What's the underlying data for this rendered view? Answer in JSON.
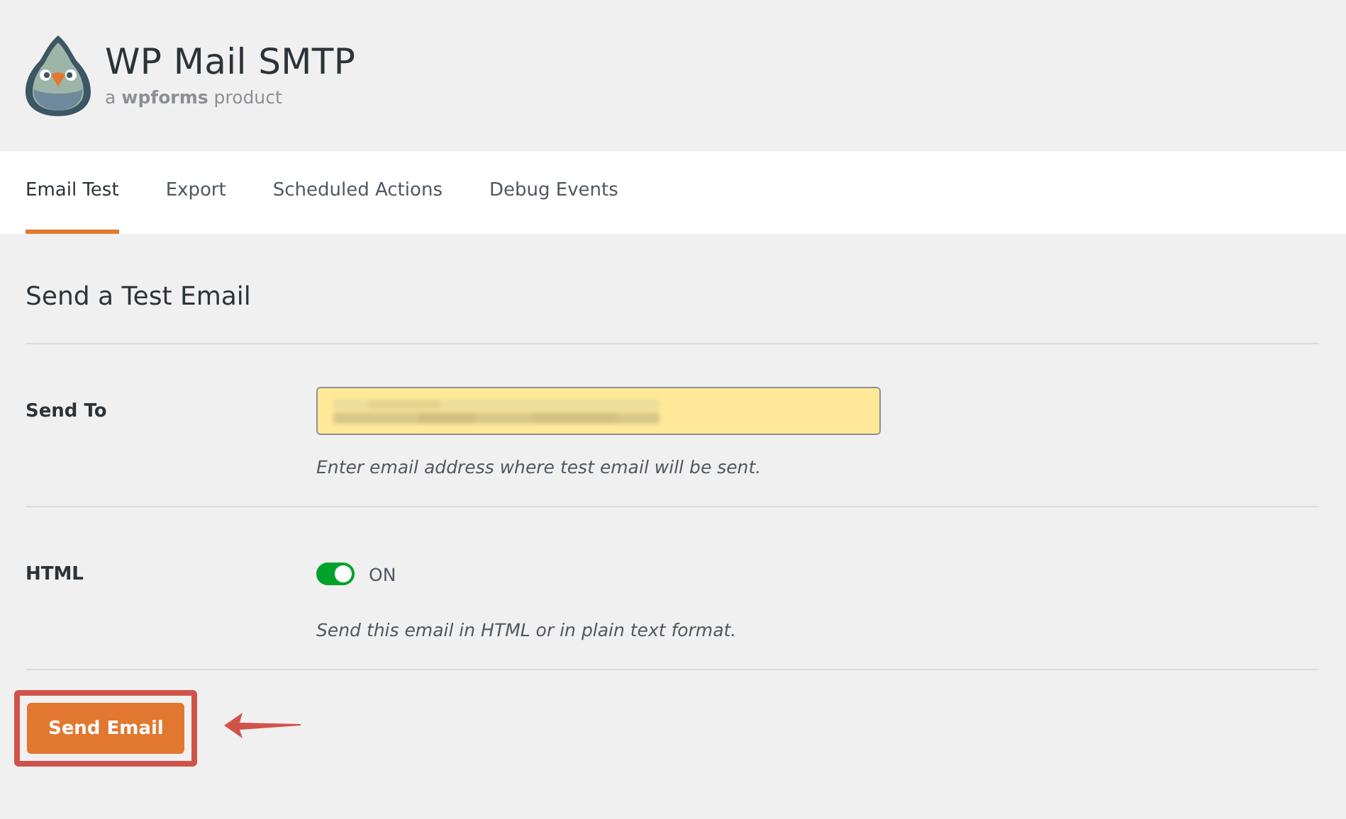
{
  "header": {
    "title": "WP Mail SMTP",
    "tagline": "a **wpforms** product"
  },
  "tabs": [
    {
      "label": "Email Test",
      "selected": true
    },
    {
      "label": "Export",
      "selected": false
    },
    {
      "label": "Scheduled Actions",
      "selected": false
    },
    {
      "label": "Debug Events",
      "selected": false
    }
  ],
  "section_title": "Send a Test Email",
  "rows": [
    {
      "kind": "field",
      "label": "Send To",
      "help": "Enter email address where test email will be sent."
    },
    {
      "kind": "toggle",
      "label": "HTML",
      "on": true,
      "state_label": "ON",
      "help": "Send this email in HTML or in plain text format."
    }
  ],
  "submit": {
    "label": "Send Email",
    "highlighted": true
  }
}
